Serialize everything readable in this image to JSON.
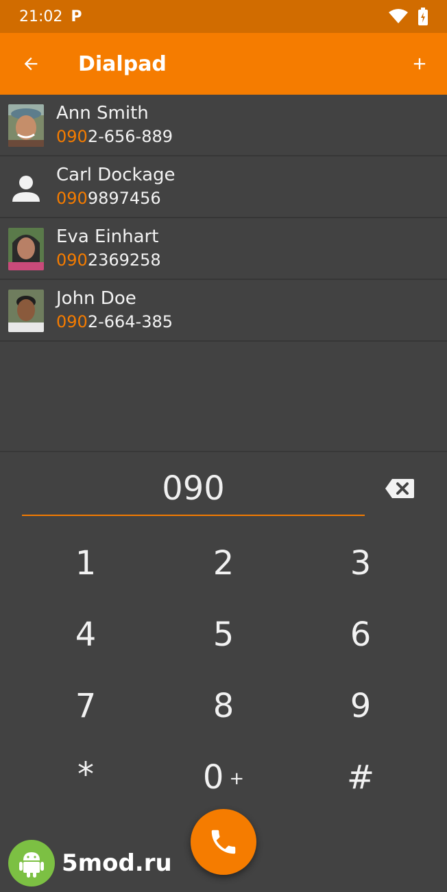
{
  "status_bar": {
    "time": "21:02",
    "notif_letter": "P"
  },
  "app_bar": {
    "title": "Dialpad"
  },
  "contacts": [
    {
      "name": "Ann Smith",
      "number_match": "090",
      "number_rest": "2-656-889",
      "avatar": "photo"
    },
    {
      "name": "Carl Dockage",
      "number_match": "090",
      "number_rest": "9897456",
      "avatar": "placeholder"
    },
    {
      "name": "Eva Einhart",
      "number_match": "090",
      "number_rest": "2369258",
      "avatar": "photo"
    },
    {
      "name": "John Doe",
      "number_match": "090",
      "number_rest": "2-664-385",
      "avatar": "photo"
    }
  ],
  "dial": {
    "value": "090"
  },
  "keypad": [
    {
      "label": "1"
    },
    {
      "label": "2"
    },
    {
      "label": "3"
    },
    {
      "label": "4"
    },
    {
      "label": "5"
    },
    {
      "label": "6"
    },
    {
      "label": "7"
    },
    {
      "label": "8"
    },
    {
      "label": "9"
    },
    {
      "label": "*"
    },
    {
      "label": "0",
      "sub": "+"
    },
    {
      "label": "#"
    }
  ],
  "watermark": {
    "text": "5mod.ru"
  },
  "colors": {
    "accent": "#f57c00",
    "status_bar": "#d16c00",
    "background": "#424242"
  }
}
